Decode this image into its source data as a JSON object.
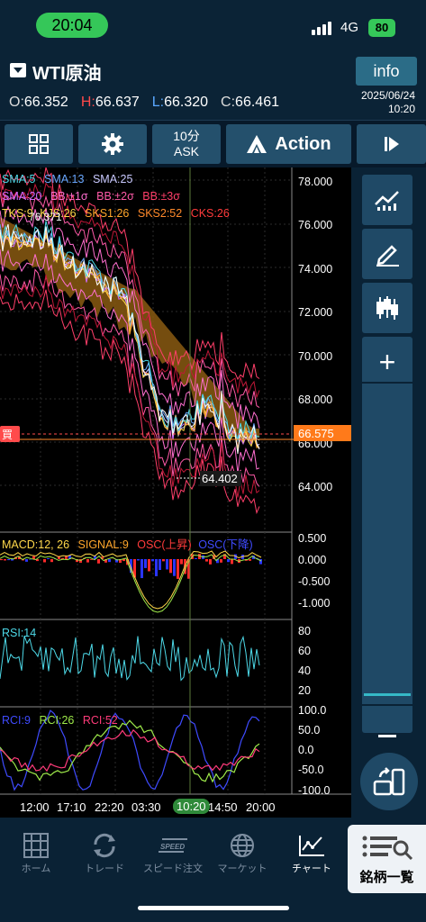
{
  "status_bar": {
    "time": "20:04",
    "network": "4G",
    "battery": "80"
  },
  "header": {
    "symbol": "WTI原油",
    "info_label": "info",
    "ohlc": [
      {
        "key": "O:",
        "value": "66.352"
      },
      {
        "key": "H:",
        "value": "66.637"
      },
      {
        "key": "L:",
        "value": "66.320"
      },
      {
        "key": "C:",
        "value": "66.461"
      }
    ],
    "date": "2025/06/24",
    "time": "10:20"
  },
  "toolbar": {
    "timeframe": "10分",
    "price_side": "ASK",
    "action_label": "Action"
  },
  "chart": {
    "legend_row1": [
      {
        "text": "SMA:5",
        "color": "#4dd9e8"
      },
      {
        "text": "SMA:13",
        "color": "#6aa8ff"
      },
      {
        "text": "SMA:25",
        "color": "#c9c9ff"
      }
    ],
    "legend_row2": [
      {
        "text": "SMA:20",
        "color": "#d06cff"
      },
      {
        "text": "BB:±1σ",
        "color": "#ff6fd0"
      },
      {
        "text": "BB:±2σ",
        "color": "#ff5aa8"
      },
      {
        "text": "BB:±3σ",
        "color": "#ff3f6a"
      }
    ],
    "legend_row3": [
      {
        "text": "TKS:9",
        "color": "#ffd84a"
      },
      {
        "text": "KJS:26",
        "color": "#ffd84a"
      },
      {
        "text": "SKS1:26",
        "color": "#ffa62b"
      },
      {
        "text": "SKS2:52",
        "color": "#ff8a2b"
      },
      {
        "text": "CKS:26",
        "color": "#ff3b3b"
      }
    ],
    "price_axis": [
      "78.000",
      "76.000",
      "74.000",
      "72.000",
      "70.000",
      "68.000",
      "66.000",
      "64.000"
    ],
    "high_marker": "76.371",
    "low_marker": "64.402",
    "current_price": "66.575",
    "buy_tag": "買",
    "macd_legend": [
      {
        "text": "MACD:12, 26",
        "color": "#ffd84a"
      },
      {
        "text": "SIGNAL:9",
        "color": "#ffa62b"
      },
      {
        "text": "OSC(上昇)",
        "color": "#ff3b3b"
      },
      {
        "text": "OSC(下降)",
        "color": "#3f4bff"
      }
    ],
    "macd_axis": [
      "0.500",
      "0.000",
      "-0.500",
      "-1.000"
    ],
    "rsi_legend": {
      "text": "RSI:14",
      "color": "#4dd9e8"
    },
    "rsi_axis": [
      "80",
      "60",
      "40",
      "20"
    ],
    "rci_legend": [
      {
        "text": "RCI:9",
        "color": "#3f4bff"
      },
      {
        "text": "RCI:26",
        "color": "#9eea4a"
      },
      {
        "text": "RCI:52",
        "color": "#ff3b7a"
      }
    ],
    "rci_axis": [
      "100.0",
      "50.0",
      "0.0",
      "-50.0",
      "-100.0"
    ],
    "time_axis": [
      "12:00",
      "17:10",
      "22:20",
      "03:30",
      "14:50",
      "20:00"
    ],
    "crosshair_time": "10:20"
  },
  "bottom_nav": [
    {
      "label": "ホーム",
      "icon": "grid-icon"
    },
    {
      "label": "トレード",
      "icon": "refresh-arrows-icon"
    },
    {
      "label": "スピード注文",
      "icon": "speed-icon"
    },
    {
      "label": "マーケット",
      "icon": "globe-icon"
    },
    {
      "label": "チャート",
      "icon": "chart-icon"
    }
  ],
  "meigara_label": "銘柄一覧",
  "colors": {
    "accent": "#35c759",
    "panel": "#0a2235",
    "button": "#24506c",
    "price_tag": "#ff7a1a"
  }
}
